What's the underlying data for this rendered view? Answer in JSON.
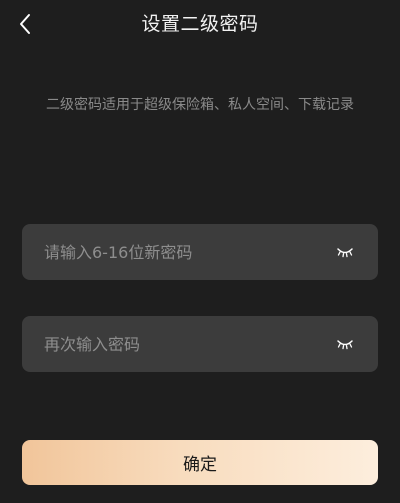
{
  "header": {
    "back_icon": "chevron-left-icon",
    "title": "设置二级密码"
  },
  "description": "二级密码适用于超级保险箱、私人空间、下载记录",
  "form": {
    "new_password": {
      "value": "",
      "placeholder": "请输入6-16位新密码",
      "toggle_icon": "eye-closed-icon"
    },
    "confirm_password": {
      "value": "",
      "placeholder": "再次输入密码",
      "toggle_icon": "eye-closed-icon"
    }
  },
  "confirm_button": {
    "label": "确定"
  },
  "colors": {
    "background": "#1e1e1e",
    "field_background": "#3c3c3c",
    "placeholder": "#8e8e8e",
    "description": "#8a8a8a",
    "button_gradient_start": "#f1c59a",
    "button_gradient_end": "#fdeedd",
    "button_text": "#1a1a1a"
  }
}
